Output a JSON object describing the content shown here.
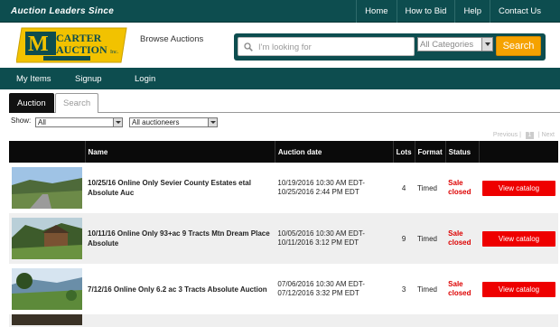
{
  "topbar": {
    "tagline": "Auction Leaders Since",
    "nav": [
      "Home",
      "How to Bid",
      "Help",
      "Contact Us"
    ]
  },
  "header": {
    "logo_text": "McCARTER AUCTION Inc.",
    "browse_label": "Browse Auctions",
    "search_placeholder": "I'm looking for",
    "category_value": "All Categories",
    "search_button": "Search"
  },
  "subnav": [
    "My Items",
    "Signup",
    "Login"
  ],
  "tabs": [
    "Auction",
    "Search"
  ],
  "filters": {
    "show_label": "Show:",
    "show_value": "All",
    "auctioneer_value": "All auctioneers"
  },
  "pager": {
    "previous": "Previous",
    "next": "Next"
  },
  "table": {
    "headers": [
      "",
      "Name",
      "Auction date",
      "Lots",
      "Format",
      "Status",
      ""
    ],
    "rows": [
      {
        "name": "10/25/16 Online Only Sevier County Estates etal Absolute Auc",
        "date": "10/19/2016 10:30 AM EDT-10/25/2016 2:44 PM EDT",
        "lots": "4",
        "format": "Timed",
        "status": "Sale closed",
        "button": "View catalog"
      },
      {
        "name": "10/11/16 Online Only 93+ac 9 Tracts Mtn Dream Place Absolute",
        "date": "10/05/2016 10:30 AM EDT-10/11/2016 3:12 PM EDT",
        "lots": "9",
        "format": "Timed",
        "status": "Sale closed",
        "button": "View catalog"
      },
      {
        "name": "7/12/16 Online Only 6.2 ac 3 Tracts Absolute Auction",
        "date": "07/06/2016 10:30 AM EDT-07/12/2016 3:32 PM EDT",
        "lots": "3",
        "format": "Timed",
        "status": "Sale closed",
        "button": "View catalog"
      }
    ]
  },
  "colors": {
    "brand_teal": "#0d4d4f",
    "search_orange": "#f5a200",
    "status_red": "#dd0000"
  }
}
